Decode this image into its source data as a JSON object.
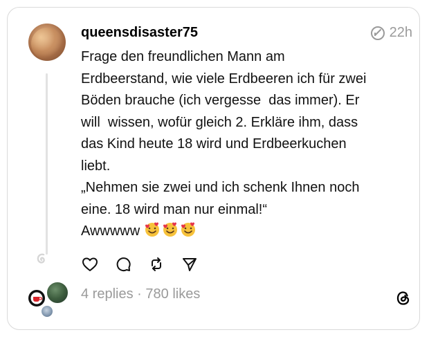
{
  "post": {
    "username": "queensdisaster75",
    "time": "22h",
    "lines": [
      "Frage den freundlichen Mann am",
      "Erdbeerstand, wie viele Erdbeeren ich für zwei",
      "Böden brauche (ich vergesse  das immer). Er",
      "will  wissen, wofür gleich 2. Erkläre ihm, dass",
      "das Kind heute 18 wird und Erdbeerkuchen",
      "liebt.",
      "„Nehmen sie zwei und ich schenk Ihnen noch",
      "eine. 18 wird man nur einmal!“",
      "Awwwww"
    ],
    "emoji_count": 3
  },
  "actions": {
    "icons": [
      "heart-icon",
      "comment-icon",
      "repost-icon",
      "share-icon"
    ]
  },
  "stats": {
    "replies": "4 replies",
    "separator": " · ",
    "likes": "780 likes"
  },
  "icons": {
    "meta": "edited-clock-icon",
    "logo": "threads-logo-icon"
  }
}
